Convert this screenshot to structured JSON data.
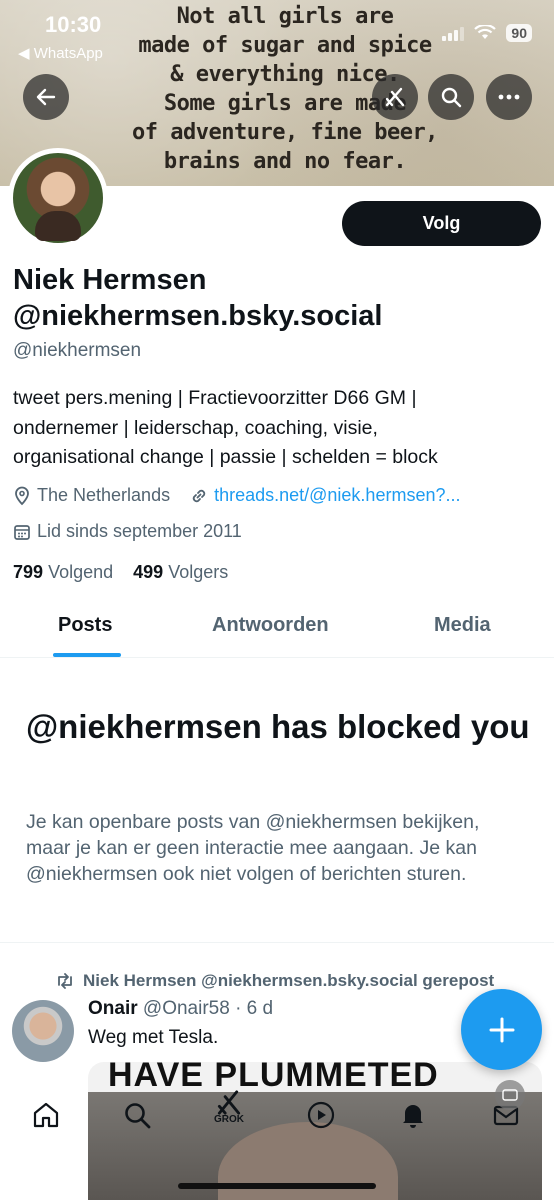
{
  "status_bar": {
    "time": "10:30",
    "back_app": "◀ WhatsApp",
    "battery": "90"
  },
  "banner": {
    "quote": "Not all girls are\nmade of sugar and spice\n& everything nice.\nSome girls are made\nof adventure, fine beer,\nbrains and no fear."
  },
  "profile": {
    "name": "Niek Hermsen",
    "display_handle": "@niekhermsen.bsky.social",
    "handle": "@niekhermsen",
    "follow_label": "Volg",
    "bio_lines": [
      "tweet pers.mening | Fractievoorzitter D66 GM |",
      "ondernemer | leiderschap, coaching, visie,",
      "organisational change | passie | schelden = block"
    ],
    "location": "The Netherlands",
    "link": "threads.net/@niek.hermsen?...",
    "joined": "Lid sinds september 2011",
    "following_count": "799",
    "following_label": "Volgend",
    "followers_count": "499",
    "followers_label": "Volgers"
  },
  "tabs": [
    {
      "label": "Posts",
      "active": true
    },
    {
      "label": "Antwoorden",
      "active": false
    },
    {
      "label": "Media",
      "active": false
    }
  ],
  "blocked": {
    "title": "@niekhermsen has blocked you",
    "text": "Je kan openbare posts van @niekhermsen bekijken, maar je kan er geen interactie mee aangaan. Je kan @niekhermsen ook niet volgen of berichten sturen."
  },
  "post": {
    "repost_label": "Niek Hermsen @niekhermsen.bsky.social gerepost",
    "author_name": "Onair",
    "author_handle_time": "@Onair58 · 6 d",
    "text": "Weg met Tesla.",
    "media_caption": "HAVE PLUMMETED"
  },
  "bottom_nav": {
    "grok_label": "GROK"
  },
  "colors": {
    "accent": "#1d9bf0",
    "text": "#0f1419",
    "secondary": "#536471"
  },
  "icons": [
    "back-arrow-icon",
    "grok-icon",
    "search-icon",
    "more-icon",
    "location-pin-icon",
    "link-icon",
    "calendar-icon",
    "repost-icon",
    "plus-icon",
    "home-icon",
    "play-icon",
    "bell-icon",
    "mail-icon"
  ]
}
